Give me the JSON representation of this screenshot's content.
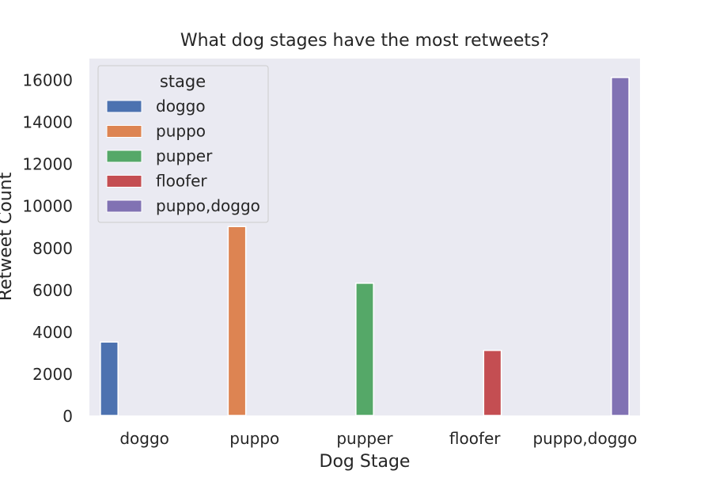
{
  "chart_data": {
    "type": "bar",
    "title": "What dog stages have the most retweets?",
    "xlabel": "Dog Stage",
    "ylabel": "Retweet Count",
    "categories": [
      "doggo",
      "puppo",
      "pupper",
      "floofer",
      "puppo,doggo"
    ],
    "yticks": [
      0,
      2000,
      4000,
      6000,
      8000,
      10000,
      12000,
      14000,
      16000
    ],
    "ylim": [
      0,
      17000
    ],
    "grid": false,
    "legend": {
      "title": "stage",
      "placement": "top-left"
    },
    "series": [
      {
        "name": "doggo",
        "color": "#4c72b0",
        "category": "doggo",
        "value": 3500
      },
      {
        "name": "puppo",
        "color": "#dd8452",
        "category": "puppo",
        "value": 9000
      },
      {
        "name": "pupper",
        "color": "#55a868",
        "category": "pupper",
        "value": 6300
      },
      {
        "name": "floofer",
        "color": "#c44e52",
        "category": "floofer",
        "value": 3100
      },
      {
        "name": "puppo,doggo",
        "color": "#8172b3",
        "category": "puppo,doggo",
        "value": 16100
      }
    ]
  }
}
